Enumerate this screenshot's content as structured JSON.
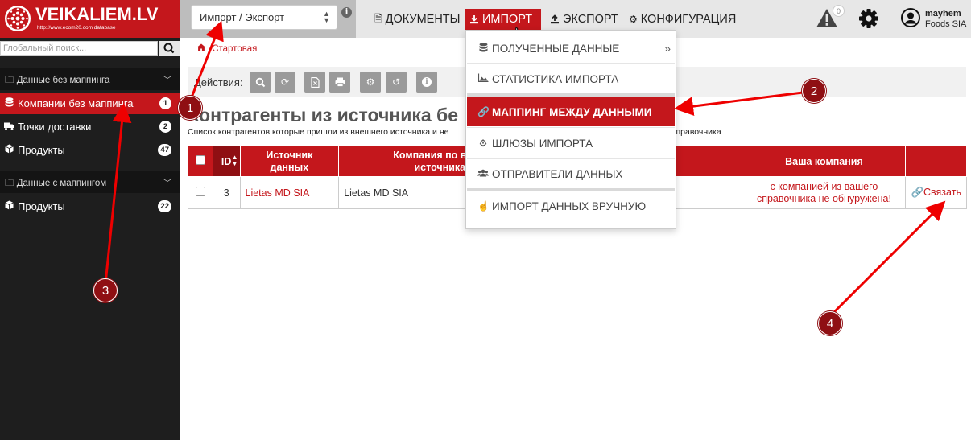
{
  "logo": {
    "name": "VEIKALIEM.LV",
    "url": "http://www.ecom20.com database"
  },
  "module_select": {
    "value": "Импорт / Экспорт"
  },
  "topnav": [
    {
      "label": "Документы",
      "icon": "document-icon"
    },
    {
      "label": "Импорт",
      "icon": "download-icon"
    },
    {
      "label": "Экспорт",
      "icon": "upload-icon"
    },
    {
      "label": "Конфигурация",
      "icon": "cogs-icon"
    }
  ],
  "alerts": {
    "count": "0"
  },
  "user": {
    "name": "mayhem",
    "org": "Foods SIA"
  },
  "sidebar": {
    "search_placeholder": "Глобальный поиск...",
    "group1": {
      "label": "Данные без маппинга"
    },
    "items1": [
      {
        "label": "Компании без маппинга",
        "count": "1"
      },
      {
        "label": "Точки доставки",
        "count": "2"
      },
      {
        "label": "Продукты",
        "count": "47"
      }
    ],
    "group2": {
      "label": "Данные с маппингом"
    },
    "items2": [
      {
        "label": "Продукты",
        "count": "22"
      }
    ]
  },
  "breadcrumb": {
    "label": "Стартовая"
  },
  "actions": {
    "label": "Действия:"
  },
  "page": {
    "title": "Контрагенты из источника бе",
    "subtitle_left": "Список контрагентов которые пришли из внешнего источника и не",
    "subtitle_right": "о справочника"
  },
  "table": {
    "headers": {
      "id": "ID",
      "source": "Источник данных",
      "company": "Компания по вер... источника",
      "your_company": "Ваша компания"
    },
    "rows": [
      {
        "id": "3",
        "source": "Lietas MD SIA",
        "company": "Lietas MD SIA",
        "status": "с компанией из вашего справочника не обнуружена!",
        "action": "Связать"
      }
    ]
  },
  "dropdown": {
    "items": [
      {
        "label": "Полученные данные",
        "icon": "database-icon"
      },
      {
        "label": "Статистика импорта",
        "icon": "area-chart-icon"
      },
      {
        "label": "Маппинг между данными",
        "icon": "link-icon"
      },
      {
        "label": "Шлюзы импорта",
        "icon": "cogs-icon"
      },
      {
        "label": "Отправители данных",
        "icon": "users-icon"
      },
      {
        "label": "Импорт данных вручную",
        "icon": "hand-pointer-icon"
      }
    ]
  },
  "annotations": [
    "1",
    "2",
    "3",
    "4"
  ],
  "colors": {
    "accent": "#c4171c",
    "dark_accent": "#8f0f13",
    "sidebar": "#1e1e1e"
  }
}
